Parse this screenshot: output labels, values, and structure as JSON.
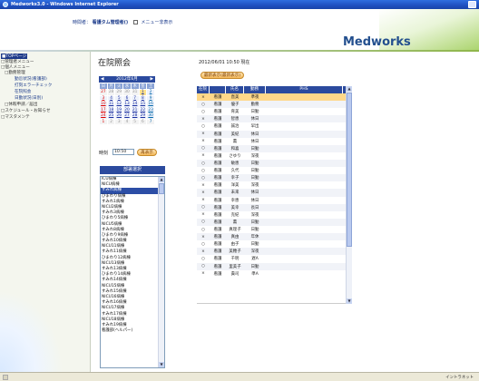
{
  "window": {
    "title": "Medworks3.0 - Windows Internet Explorer"
  },
  "header": {
    "user_label": "時間者：",
    "user_name": "看護タム管理者()",
    "menu_toggle_label": "メニュー非表示",
    "logo": "Medworks"
  },
  "sidebar": {
    "items": [
      {
        "label": "■TOPページ"
      },
      {
        "label": "□管理者メニュー"
      },
      {
        "label": "□個人メニュー"
      },
      {
        "label": "□勤務管理"
      },
      {
        "label": "勤怠状況(看護部)"
      },
      {
        "label": "打刻エラーチェック"
      },
      {
        "label": "在院照会"
      },
      {
        "label": "日勤状況(日別)"
      },
      {
        "label": "□休暇申請／届出"
      },
      {
        "label": "□スケジュール・お知らせ"
      },
      {
        "label": "□マスタメンテ"
      }
    ]
  },
  "main": {
    "title": "在院照会",
    "datestamp": "2012/06/01 10:50 現在",
    "refresh_button": "最新表示(最新表示)",
    "calendar": {
      "month_label": "2012年6月",
      "weekdays": [
        "日",
        "月",
        "火",
        "水",
        "木",
        "金",
        "土"
      ],
      "weeks": [
        [
          "27",
          "28",
          "29",
          "30",
          "31",
          "1",
          "2"
        ],
        [
          "3",
          "4",
          "5",
          "6",
          "7",
          "8",
          "9"
        ],
        [
          "10",
          "11",
          "12",
          "13",
          "14",
          "15",
          "16"
        ],
        [
          "17",
          "18",
          "19",
          "20",
          "21",
          "22",
          "23"
        ],
        [
          "24",
          "25",
          "26",
          "27",
          "28",
          "29",
          "30"
        ],
        [
          "1",
          "2",
          "3",
          "4",
          "5",
          "6",
          "7"
        ]
      ]
    },
    "time_label": "時刻",
    "time_value": "10:50",
    "redisplay_button": "再表示",
    "ward_header": "部署選択",
    "wards": [
      "ICU病棟",
      "NICU病棟",
      "すみれ病棟",
      "ひまわり病棟",
      "すみれ1病棟",
      "NICU2病棟",
      "すみれ3病棟",
      "ひまわり5病棟",
      "NICU5病棟",
      "すみれ8病棟",
      "ひまわり9病棟",
      "すみれ10病棟",
      "NICU11病棟",
      "すみれ11病棟",
      "ひまわり12病棟",
      "NICU13病棟",
      "すみれ13病棟",
      "ひまわり14病棟",
      "すみれ14病棟",
      "NICU15病棟",
      "すみれ15病棟",
      "NICU16病棟",
      "すみれ16病棟",
      "NICU17病棟",
      "すみれ17病棟",
      "NICU18病棟",
      "すみれ19病棟",
      "看護部(ヘルパー)"
    ],
    "selected_ward": "すみれ病棟",
    "table": {
      "headers": [
        "在院",
        "氏名",
        "",
        "勤務",
        "PHS"
      ],
      "rows": [
        [
          "×",
          "看護",
          "直美",
          "準夜",
          ""
        ],
        [
          "○",
          "看護",
          "優子",
          "勤務",
          ""
        ],
        [
          "○",
          "看護",
          "育美",
          "日勤",
          ""
        ],
        [
          "×",
          "看護",
          "智恵",
          "休日",
          ""
        ],
        [
          "○",
          "看護",
          "誠治",
          "早出",
          ""
        ],
        [
          "×",
          "看護",
          "美紀",
          "休日",
          ""
        ],
        [
          "×",
          "看護",
          "薫",
          "休日",
          ""
        ],
        [
          "○",
          "看護",
          "和喜",
          "日勤",
          ""
        ],
        [
          "×",
          "看護",
          "さゆり",
          "深夜",
          ""
        ],
        [
          "○",
          "看護",
          "敏恵",
          "日勤",
          ""
        ],
        [
          "○",
          "看護",
          "久代",
          "日勤",
          ""
        ],
        [
          "○",
          "看護",
          "幸子",
          "日勤",
          ""
        ],
        [
          "×",
          "看護",
          "洋美",
          "深夜",
          ""
        ],
        [
          "×",
          "看護",
          "未来",
          "休日",
          ""
        ],
        [
          "×",
          "看護",
          "幸恵",
          "休日",
          ""
        ],
        [
          "○",
          "看護",
          "美幸",
          "長日",
          ""
        ],
        [
          "×",
          "看護",
          "克紀",
          "深夜",
          ""
        ],
        [
          "○",
          "看護",
          "薫",
          "日勤",
          ""
        ],
        [
          "○",
          "看護",
          "真理子",
          "日勤",
          ""
        ],
        [
          "×",
          "看護",
          "真由",
          "年休",
          ""
        ],
        [
          "○",
          "看護",
          "由子",
          "日勤",
          ""
        ],
        [
          "×",
          "看護",
          "美穂子",
          "深夜",
          ""
        ],
        [
          "○",
          "看護",
          "千明",
          "遅A",
          ""
        ],
        [
          "○",
          "看護",
          "里美子",
          "日勤",
          ""
        ],
        [
          "×",
          "看護",
          "貴司",
          "準A",
          ""
        ]
      ]
    }
  },
  "statusbar": {
    "zone": "イントラネット"
  },
  "colors": {
    "accent_blue": "#2b4a9e",
    "highlight": "#ffd889",
    "brand_green": "#8fb64a"
  }
}
